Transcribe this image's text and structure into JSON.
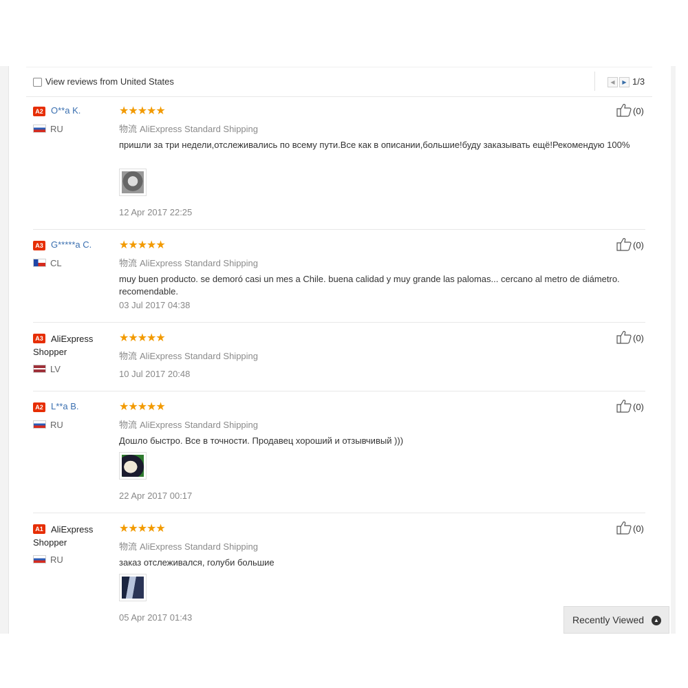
{
  "filter": {
    "label": "View reviews from United States",
    "page_indicator": "1/3"
  },
  "reviews": [
    {
      "badge": "A2",
      "name": "O**a K.",
      "country": "RU",
      "stars": "★★★★★",
      "logistics": "物流",
      "shipping": "AliExpress Standard Shipping",
      "comment": "пришли за три недели,отслеживались по всему пути.Все как в описании,большие!буду заказывать ещё!Рекомендую 100%",
      "date": "12 Apr 2017 22:25",
      "helpful": "(0)"
    },
    {
      "badge": "A3",
      "name": "G*****a C.",
      "country": "CL",
      "stars": "★★★★★",
      "logistics": "物流",
      "shipping": "AliExpress Standard Shipping",
      "comment": "muy buen producto. se demoró casi un mes a Chile. buena calidad y muy grande las palomas... cercano al metro de diámetro. recomendable.",
      "date": "03 Jul 2017 04:38",
      "helpful": "(0)"
    },
    {
      "badge": "A3",
      "name": "AliExpress Shopper",
      "country": "LV",
      "stars": "★★★★★",
      "logistics": "物流",
      "shipping": "AliExpress Standard Shipping",
      "comment": "",
      "date": "10 Jul 2017 20:48",
      "helpful": "(0)"
    },
    {
      "badge": "A2",
      "name": "L**a B.",
      "country": "RU",
      "stars": "★★★★★",
      "logistics": "物流",
      "shipping": "AliExpress Standard Shipping",
      "comment": "Дошло быстро. Все в точности. Продавец хороший и отзывчивый )))",
      "date": "22 Apr 2017 00:17",
      "helpful": "(0)"
    },
    {
      "badge": "A1",
      "name": "AliExpress Shopper",
      "country": "RU",
      "stars": "★★★★★",
      "logistics": "物流",
      "shipping": "AliExpress Standard Shipping",
      "comment": "заказ отслеживался, голуби большие",
      "date": "05 Apr 2017 01:43",
      "helpful": "(0)"
    }
  ],
  "recently_viewed": {
    "label": "Recently Viewed",
    "icon": "chevron-up-icon"
  },
  "colors": {
    "badge": "#e62e04",
    "stars": "#f29a00",
    "link": "#3a6fb0"
  }
}
